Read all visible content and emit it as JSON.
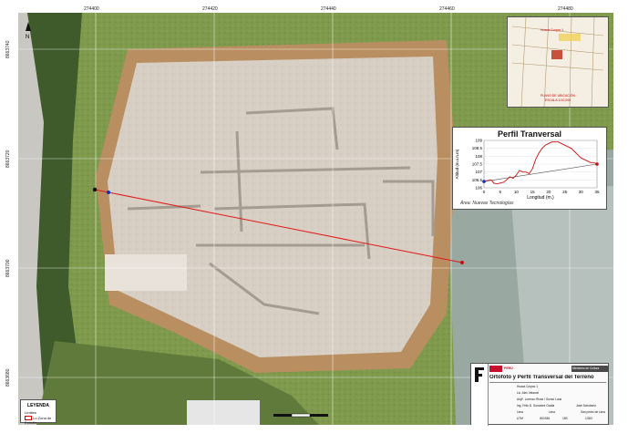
{
  "grid": {
    "top_ticks": [
      "274400",
      "274420",
      "274440",
      "274460",
      "274480"
    ],
    "left_ticks": [
      "8663740",
      "8663720",
      "8663700",
      "8663680"
    ]
  },
  "profile": {
    "title": "Perfil Tranversal",
    "ylabel": "Altitud (m.s.n.m)",
    "xlabel": "Longitud (m.)",
    "note": "Área: Nuevas Tecnologías",
    "chart_data": {
      "type": "line",
      "xlabel": "Longitud (m.)",
      "ylabel": "Altitud (m.s.n.m)",
      "xlim": [
        0,
        35
      ],
      "ylim": [
        106,
        109
      ],
      "x_ticks": [
        "0",
        "5",
        "10",
        "15",
        "20",
        "25",
        "30",
        "35"
      ],
      "y_ticks": [
        "106",
        "106.5",
        "107",
        "107.5",
        "108",
        "108.5",
        "109"
      ],
      "series": [
        {
          "x": [
            0,
            1,
            2,
            2.5,
            3,
            4,
            5,
            6,
            7,
            8,
            9,
            10,
            11,
            12,
            13,
            14,
            15,
            16,
            17,
            18,
            19,
            20,
            21,
            22,
            23,
            24,
            25,
            26,
            27,
            28,
            29,
            30,
            31,
            32,
            33,
            34,
            35
          ],
          "y": [
            106.4,
            106.45,
            106.5,
            106.45,
            106.3,
            106.25,
            106.3,
            106.35,
            106.5,
            106.7,
            106.6,
            106.8,
            107.1,
            107.0,
            107.0,
            106.9,
            107.2,
            107.8,
            108.2,
            108.5,
            108.7,
            108.8,
            108.9,
            108.9,
            108.9,
            108.8,
            108.7,
            108.6,
            108.5,
            108.3,
            108.1,
            107.9,
            107.8,
            107.7,
            107.6,
            107.6,
            107.5
          ]
        }
      ],
      "reference_line": {
        "x": [
          0,
          35
        ],
        "y": [
          106.4,
          107.5
        ]
      },
      "colors": {
        "series": "#d01010",
        "reference": "#555555",
        "start_point": "#1030c0",
        "end_point": "#c01010"
      }
    }
  },
  "legend": {
    "title": "LEYENDA",
    "subtitle": "Límites",
    "item": "Lo Zona de Estudio"
  },
  "title_block": {
    "ministry": "Ministerio de Cultura",
    "country": "PERÚ",
    "title": "Ortofoto y Perfil Transversal del Terreno",
    "rows": [
      [
        "Huaca Corpac 1"
      ],
      [
        "Lic. Alex Velarcel"
      ],
      [
        "Arqtº. Lorenzo Rioss / Gonzo Luna"
      ],
      [
        "Ing. Félix D. Gonzalez Ocalla",
        "José Schubertz"
      ],
      [
        "Lima",
        "Lima",
        "San pedro de Lima"
      ],
      [
        "UTM",
        "WGS84",
        "18S",
        "1/300"
      ]
    ]
  },
  "inset": {
    "label": "Huaca Corpac 1",
    "caption_line1": "PLANO DE UBICACIÓN",
    "caption_line2": "ESCALA 1/10,000"
  },
  "colors": {
    "transect": "#e01818",
    "terrain": "#d8cfc4",
    "grass": "#7f9a4c"
  }
}
